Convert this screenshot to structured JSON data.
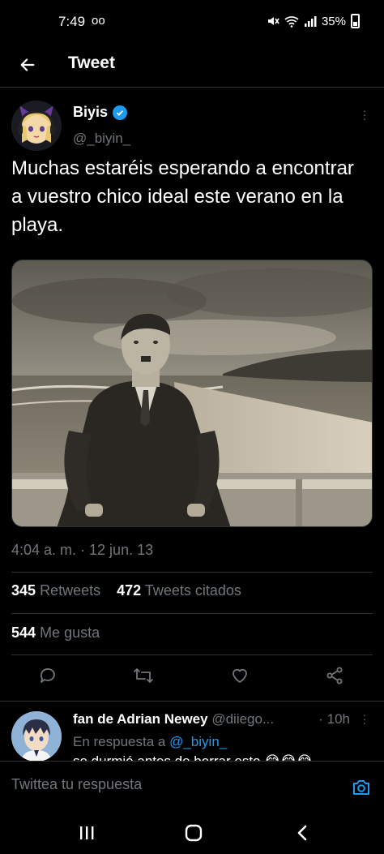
{
  "status_bar": {
    "time": "7:49",
    "voicemail": "oo",
    "battery": "35%"
  },
  "header": {
    "title": "Tweet"
  },
  "tweet": {
    "author_name": "Biyis",
    "author_handle": "@_biyin_",
    "text": "Muchas estaréis esperando a encontrar a vuestro chico ideal este verano en la playa.",
    "timestamp": "4:04 a. m. · 12 jun. 13",
    "retweets_count": "345",
    "retweets_label": "Retweets",
    "quotes_count": "472",
    "quotes_label": "Tweets citados",
    "likes_count": "544",
    "likes_label": "Me gusta"
  },
  "reply": {
    "name": "fan de Adrian Newey",
    "handle": "@diiego...",
    "time": "· 10h",
    "replying_prefix": "En respuesta a",
    "replying_mention": "@_biyin_",
    "text": "se durmió antes de borrar esto 😂😂😂"
  },
  "compose": {
    "placeholder": "Twittea tu respuesta"
  },
  "colors": {
    "accent": "#1d9bf0",
    "background": "#000000",
    "muted": "#71767b",
    "divider": "#2f3336"
  }
}
